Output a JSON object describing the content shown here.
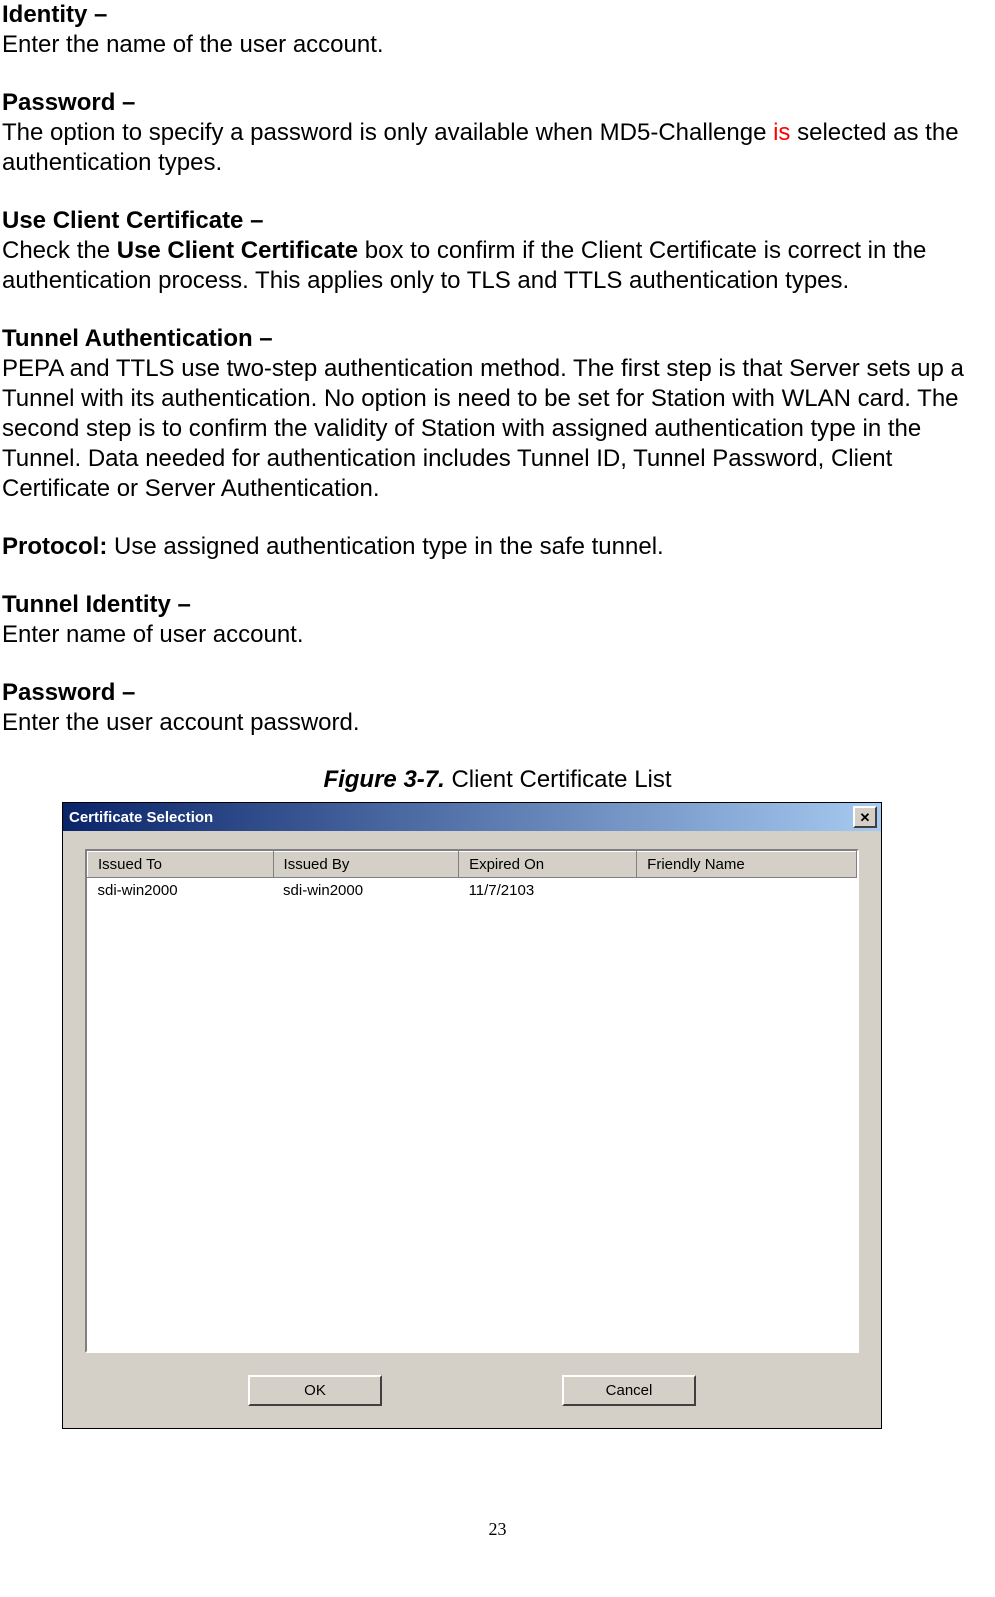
{
  "sections": {
    "identity": {
      "heading": "Identity –",
      "body": "Enter the name of the user account."
    },
    "password1": {
      "heading": "Password –",
      "body_pre": "The option to specify a password is only available when MD5-Challenge ",
      "red_word": "is",
      "body_post": " selected as the authentication types."
    },
    "useclient": {
      "heading": "Use Client Certificate –",
      "body_pre": "Check the ",
      "bold_phrase": "Use Client Certificate",
      "body_post": " box to confirm if the Client Certificate is correct in the authentication process. This applies only to TLS and TTLS authentication types."
    },
    "tunnelauth": {
      "heading": "Tunnel Authentication –",
      "body": "PEPA and TTLS use two-step authentication method. The first step is that Server sets up a Tunnel with its authentication. No option is need to be set for Station with WLAN card. The second step is to confirm the validity of Station with assigned authentication type in the Tunnel. Data needed for authentication includes Tunnel ID, Tunnel Password, Client Certificate or Server Authentication."
    },
    "protocol": {
      "label": "Protocol:",
      "body": " Use assigned authentication type in the safe tunnel."
    },
    "tunnelid": {
      "heading": "Tunnel Identity –",
      "body": "Enter name of user account."
    },
    "password2": {
      "heading": "Password –",
      "body": "Enter the user account password."
    }
  },
  "figure": {
    "number": "Figure 3-7.",
    "title": "    Client Certificate List"
  },
  "dialog": {
    "title": "Certificate Selection",
    "close_symbol": "✕",
    "columns": [
      "Issued To",
      "Issued By",
      "Expired On",
      "Friendly Name"
    ],
    "rows": [
      {
        "issued_to": "sdi-win2000",
        "issued_by": "sdi-win2000",
        "expired_on": "11/7/2103",
        "friendly_name": ""
      }
    ],
    "buttons": {
      "ok": "OK",
      "cancel": "Cancel"
    }
  },
  "page_number": "23"
}
